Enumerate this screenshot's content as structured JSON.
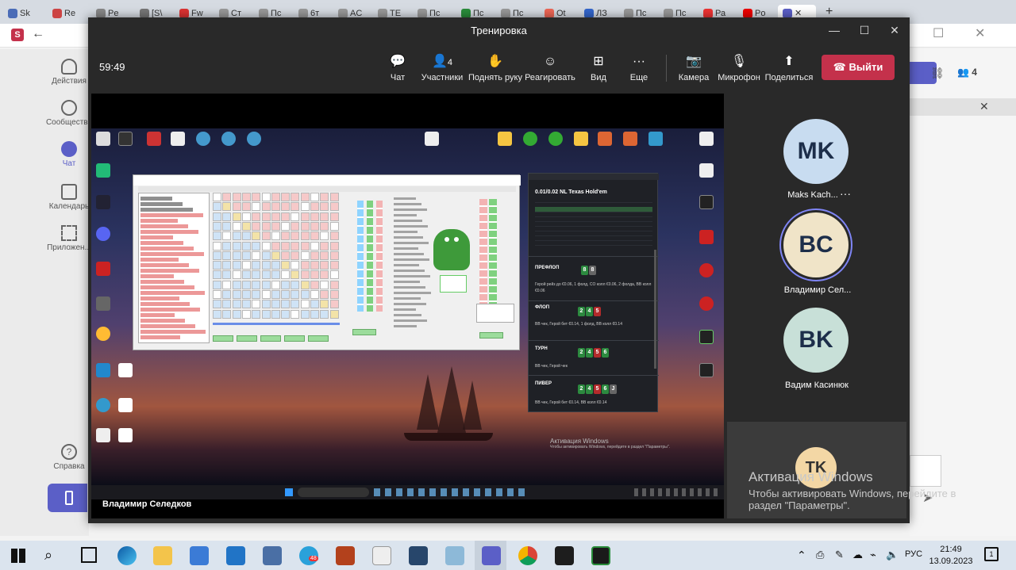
{
  "browser": {
    "tabs": [
      "Sk",
      "Re",
      "Pe",
      "[S\\",
      "Fw",
      "Ст",
      "Пс",
      "6т",
      "AC",
      "TE",
      "Пс",
      "Пс",
      "Пс",
      "Ot",
      "ЛЗ",
      "Пс",
      "Пс",
      "Ра",
      "Po"
    ]
  },
  "rail": {
    "items": [
      "Действия",
      "Сообщества",
      "Чат",
      "Календарь",
      "Приложен...",
      "Справка"
    ]
  },
  "meeting": {
    "title": "Тренировка",
    "timer": "59:49",
    "toolbar": {
      "chat": "Чат",
      "participants": "Участники",
      "participants_count": "4",
      "raise_hand": "Поднять руку",
      "react": "Реагировать",
      "view": "Вид",
      "more": "Еще",
      "camera": "Камера",
      "mic": "Микрофон",
      "share": "Поделиться",
      "leave": "Выйти"
    },
    "stage_name": "Владимир Селедков",
    "participants": [
      {
        "initials": "MK",
        "name": "Maks Kach...",
        "color": "#c8dcf0"
      },
      {
        "initials": "BC",
        "name": "Владимир Сел...",
        "color": "#f0e4c8"
      },
      {
        "initials": "BK",
        "name": "Вадим Касинюк",
        "color": "#c8e0d8"
      }
    ],
    "self_initials": "TK",
    "right_count": "4"
  },
  "shared": {
    "hh_game": "0.01/0.02 NL Texas Hold'em",
    "hh_preflop": "ПРЕФЛОП",
    "hh_flop": "ФЛОП",
    "hh_turn": "ТУРН",
    "hh_river": "ПИВЕР",
    "hh_preflop_action": "Герой рейз до €0.06, 1 фолд, CO колл €0.06, 2 фолда, BB колл €0.06",
    "hh_flop_action": "BB чек, Герой бет €0.14, 1 фолд, BB колл €0.14",
    "hh_turn_action": "BB чек, Герой чек",
    "hh_river_action": "BB чек, Герой бет €0.14, BB колл €0.14",
    "desktop_watermark_title": "Активация Windows",
    "desktop_watermark_sub": "Чтобы активировать Windows, перейдите в раздел \"Параметры\"."
  },
  "watermark": {
    "title": "Активация Windows",
    "line1": "Чтобы активировать Windows, перейдите в",
    "line2": "раздел \"Параметры\"."
  },
  "taskbar": {
    "lang": "РУС",
    "time": "21:49",
    "date": "13.09.2023",
    "notif_count": "1",
    "badge": "48"
  }
}
